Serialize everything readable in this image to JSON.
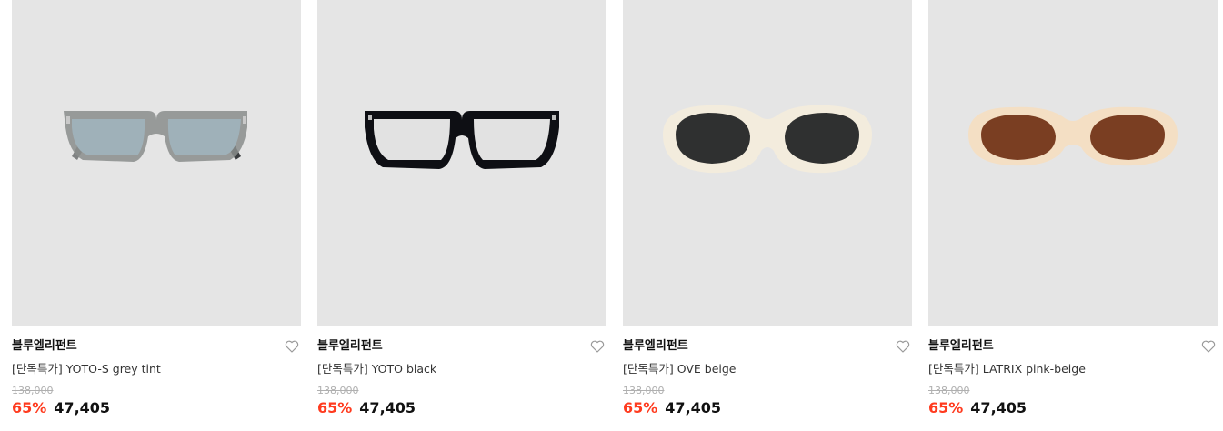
{
  "products": [
    {
      "brand": "블루엘리펀트",
      "name": "[단독특가] YOTO-S grey tint",
      "original_price": "138,000",
      "discount": "65%",
      "price": "47,405",
      "image_icon": "grey-tint-sunglasses-image"
    },
    {
      "brand": "블루엘리펀트",
      "name": "[단독특가] YOTO black",
      "original_price": "138,000",
      "discount": "65%",
      "price": "47,405",
      "image_icon": "black-glasses-image"
    },
    {
      "brand": "블루엘리펀트",
      "name": "[단독특가] OVE beige",
      "original_price": "138,000",
      "discount": "65%",
      "price": "47,405",
      "image_icon": "beige-oval-sunglasses-image"
    },
    {
      "brand": "블루엘리펀트",
      "name": "[단독특가] LATRIX pink-beige",
      "original_price": "138,000",
      "discount": "65%",
      "price": "47,405",
      "image_icon": "pink-beige-oval-sunglasses-image"
    }
  ],
  "colors": {
    "image_bg": "#e5e5e5",
    "discount": "#ff3b1f",
    "price": "#111111",
    "original_price": "#b0b0b0"
  },
  "wishlist_icon": "heart-outline-icon"
}
